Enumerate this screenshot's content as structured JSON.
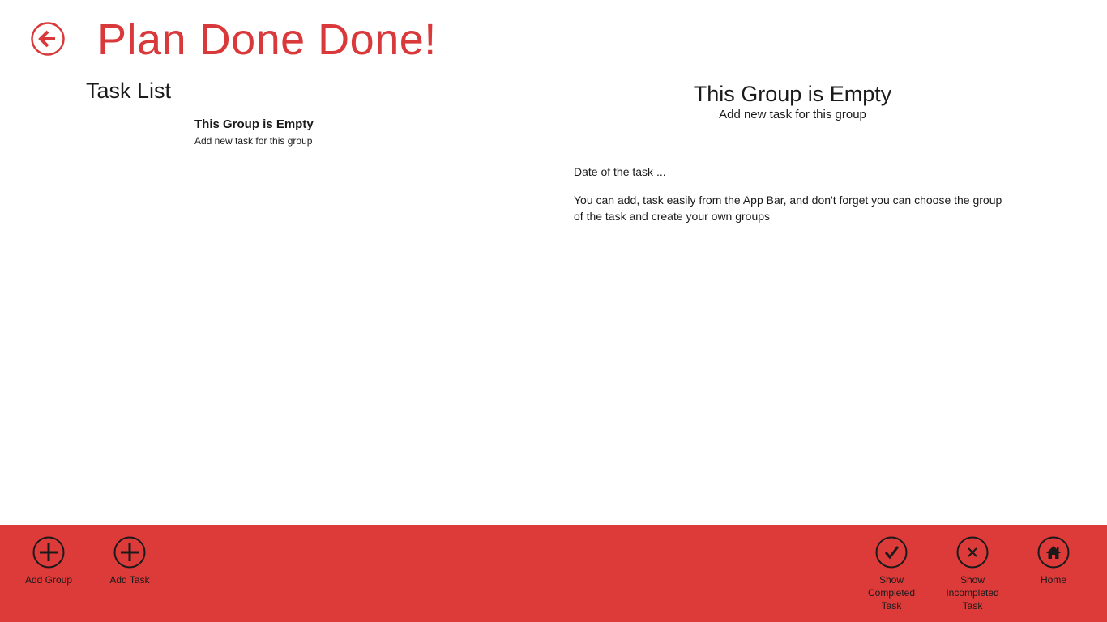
{
  "colors": {
    "accent": "#d9393a",
    "app_bar_bg": "#dd3a3a",
    "text": "#1a1a1a",
    "background": "#ffffff"
  },
  "header": {
    "back_icon": "back-arrow-icon",
    "title": "Plan Done Done!"
  },
  "task_list": {
    "heading": "Task List",
    "items": [
      {
        "title": "This Group is Empty",
        "subtitle": "Add new task for this group"
      }
    ]
  },
  "detail": {
    "title": "This Group is Empty",
    "subtitle": "Add new task for this group",
    "date": "Date of the task ...",
    "description": "You can add, task easily from the App Bar, and don't forget you can choose the group of the task and create your own groups"
  },
  "app_bar": {
    "left": [
      {
        "icon": "plus-icon",
        "label": "Add Group"
      },
      {
        "icon": "plus-icon",
        "label": "Add Task"
      }
    ],
    "right": [
      {
        "icon": "check-icon",
        "label": "Show Completed Task"
      },
      {
        "icon": "x-icon",
        "label": "Show Incompleted Task"
      },
      {
        "icon": "home-icon",
        "label": "Home"
      }
    ]
  }
}
